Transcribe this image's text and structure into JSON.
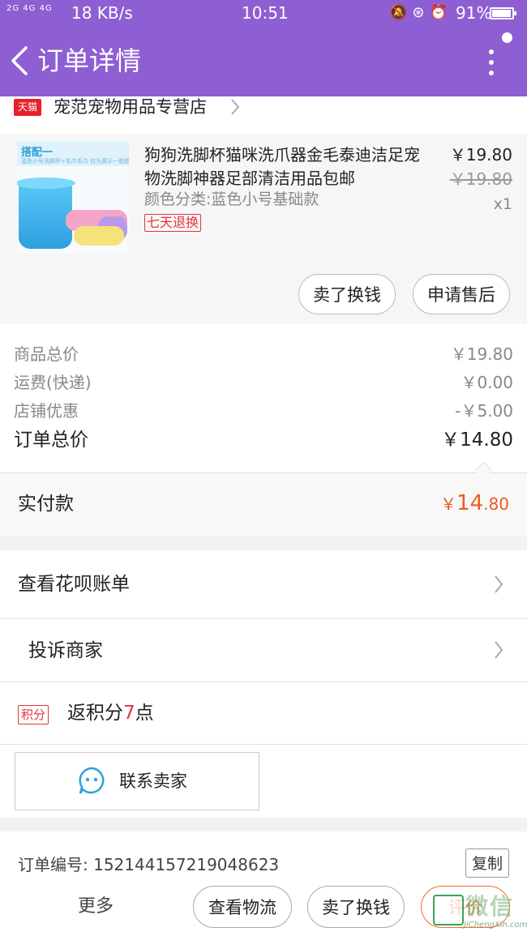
{
  "status_bar": {
    "signal": "2G 4G 4G",
    "speed": "18 KB/s",
    "time": "10:51",
    "battery": "91%"
  },
  "header": {
    "title": "订单详情"
  },
  "store": {
    "badge": "天猫",
    "name": "宠范宠物用品专营店"
  },
  "product": {
    "thumb_title": "搭配一",
    "thumb_sub": "蓝色小号洗脚杯+毛巾毛巾  仅为展示一般颜色",
    "title": "狗狗洗脚杯猫咪洗爪器金毛泰迪洁足宠物洗脚神器足部清洁用品包邮",
    "sku": "颜色分类:蓝色小号基础款",
    "tag": "七天退换",
    "price": "￥19.80",
    "original_price": "￥19.80",
    "quantity": "x1",
    "btn_sell": "卖了换钱",
    "btn_after_sale": "申请售后"
  },
  "summary": {
    "rows": [
      {
        "label": "商品总价",
        "value": "￥19.80"
      },
      {
        "label": "运费(快递)",
        "value": "￥0.00"
      },
      {
        "label": "店铺优惠",
        "value": "-￥5.00"
      }
    ],
    "total_label": "订单总价",
    "total_value": "￥14.80"
  },
  "paid": {
    "label": "实付款",
    "currency": "￥",
    "int": "14",
    "dec": ".80"
  },
  "links": {
    "huabei": "查看花呗账单",
    "complain": "投诉商家"
  },
  "points": {
    "tag": "积分",
    "prefix": "返积分",
    "num": "7",
    "suffix": "点"
  },
  "contact": {
    "label": "联系卖家"
  },
  "order": {
    "number_label": "订单编号:",
    "number": "152144157219048623",
    "copy": "复制"
  },
  "bottom_bar": {
    "more": "更多",
    "logistics": "查看物流",
    "sell": "卖了换钱",
    "rate": "评价"
  },
  "watermark": {
    "cn": "微信",
    "en": "JiChengXin.com"
  },
  "colors": {
    "brand": "#8d5fd3",
    "price_accent": "#ee5a24",
    "tag_red": "#e4343d"
  }
}
